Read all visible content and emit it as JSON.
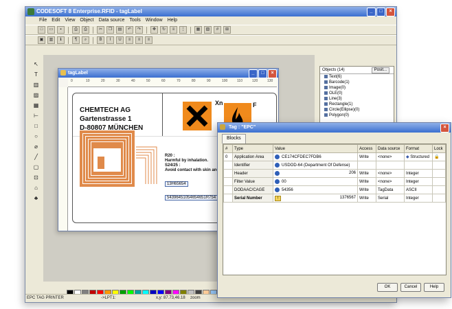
{
  "app": {
    "title": "CODESOFT 8 Enterprise.RFID - tagLabel"
  },
  "menu": [
    "File",
    "Edit",
    "View",
    "Object",
    "Data source",
    "Tools",
    "Window",
    "Help"
  ],
  "toolbar_icons": [
    "new-icon",
    "open-icon",
    "save-icon",
    "print-icon",
    "print-preview-icon",
    "cut-icon",
    "copy-icon",
    "paste-icon",
    "undo-icon",
    "redo-icon"
  ],
  "left_tools": [
    "pointer-icon",
    "text-icon",
    "barcode-icon",
    "image-icon",
    "rfid-icon",
    "line-icon",
    "rectangle-icon",
    "circle-icon",
    "ellipse-icon",
    "polygon-icon",
    "rounded-rect-icon",
    "ole-icon",
    "shape-icon",
    "rfid-tag-icon"
  ],
  "objects_panel": {
    "title": "Objects (14)",
    "position_button": "Posit...",
    "items": [
      "Text(6)",
      "Barcode(1)",
      "Image(0)",
      "OLE(0)",
      "Line(3)",
      "Rectangle(1)",
      "Circle(Ellipse)(0)",
      "Polygon(0)"
    ]
  },
  "label_window": {
    "title": "tagLabel",
    "ruler_marks": [
      "0",
      "10",
      "20",
      "30",
      "40",
      "50",
      "60",
      "70",
      "80",
      "90",
      "100",
      "110",
      "120",
      "130"
    ],
    "company_lines": [
      "CHEMTECH AG",
      "Gartenstrasse 1",
      "D-80807 MÜNCHEN"
    ],
    "hazard_codes": [
      "Xn",
      "F"
    ],
    "risk_text": [
      "R20 :",
      "Harmful by inhalation.",
      "S24/25 :",
      "Avoid contact with skin and"
    ],
    "epc_short": "13H65654",
    "epc_long": "54396451054654651R754"
  },
  "dialog": {
    "title": "Tag : \"EPC\"",
    "tab": "Blocks",
    "columns": [
      "#",
      "Type",
      "Value",
      "Access",
      "Data source",
      "Format",
      "Lock"
    ],
    "rows": [
      {
        "num": "0",
        "type": "Application Area",
        "value": "CE174CFDEC7FDB6",
        "access": "Write",
        "source": "<none>",
        "format": "Structured"
      },
      {
        "num": "",
        "type": "Identifier",
        "value": "USDOD-64 (Department Of Defense)",
        "access": "",
        "source": "",
        "format": ""
      },
      {
        "num": "",
        "type": "Header",
        "value": "",
        "extra": "206",
        "access": "Write",
        "source": "<none>",
        "format": "Integer"
      },
      {
        "num": "",
        "type": "Filter Value",
        "value": "00",
        "access": "Write",
        "source": "<none>",
        "format": "Integer"
      },
      {
        "num": "",
        "type": "DODAAC/CAGE",
        "value": "54356",
        "access": "Write",
        "source": "TagData",
        "format": "ASCII"
      },
      {
        "num": "",
        "type": "Serial Number",
        "value": "",
        "extra": "1376567",
        "access": "Write",
        "source": "Serial",
        "format": "Integer"
      }
    ],
    "buttons": {
      "ok": "OK",
      "cancel": "Cancel",
      "help": "Help"
    }
  },
  "status": {
    "printer": "EPC TAG PRINTER",
    "port": "->LPT1:",
    "coords": "x,y: 87.73,46.18",
    "zoom": "zoom"
  },
  "colors": {
    "titlebar": "#3a6fd0",
    "rfid_orange": "#e08a4a",
    "blue_dot": "#2f5fb8"
  }
}
